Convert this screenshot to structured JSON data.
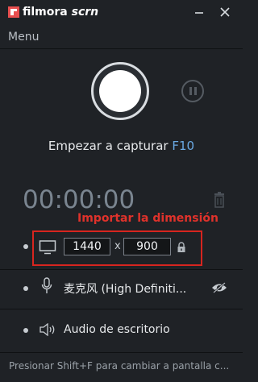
{
  "app": {
    "logo_primary": "filmora",
    "logo_secondary": "scrn"
  },
  "window_controls": {
    "minimize_icon": "minimize-icon",
    "close_icon": "close-icon"
  },
  "menu": {
    "label": "Menu"
  },
  "record": {
    "start_label": "Empezar a capturar",
    "hotkey": "F10"
  },
  "timer": {
    "value": "00:00:00"
  },
  "annotation": {
    "label": "Importar la dimensión"
  },
  "dimension": {
    "width": "1440",
    "separator": "x",
    "height": "900"
  },
  "microphone": {
    "label": "麦克风 (High Definiti..."
  },
  "desktop_audio": {
    "label": "Audio de escritorio"
  },
  "footer": {
    "hint": "Presionar Shift+F para cambiar a pantalla c..."
  },
  "colors": {
    "background": "#1f2226",
    "accent_blue": "#6aa9e3",
    "annotation_red": "#e0322b"
  }
}
